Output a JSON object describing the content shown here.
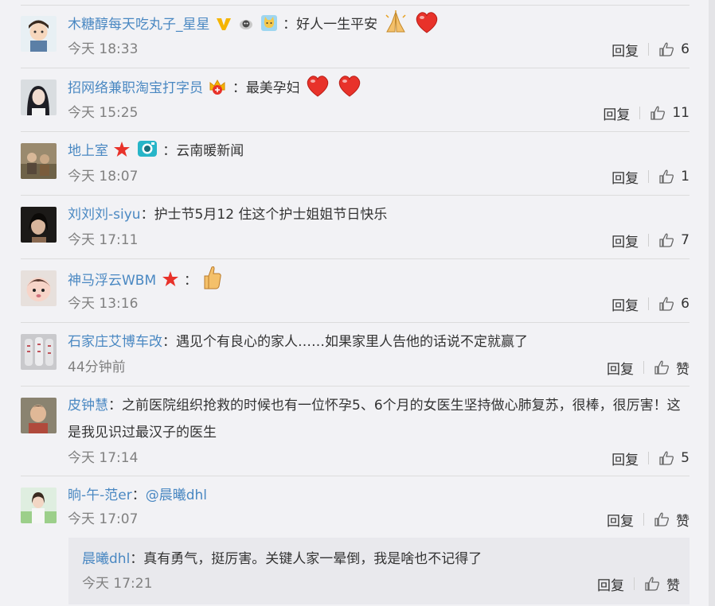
{
  "reply_label": "回复",
  "comments": [
    {
      "user": "木糖醇每天吃丸子_星星",
      "sep": "：",
      "text": "好人一生平安",
      "time": "今天 18:33",
      "likes": "6",
      "badges": [
        "verified-v-icon",
        "sheep-icon",
        "cat-badge-icon"
      ],
      "emojis": [
        "pray-emoji",
        "heart-emoji"
      ]
    },
    {
      "user": "招网络兼职淘宝打字员",
      "sep": "：",
      "text": "最美孕妇",
      "time": "今天 15:25",
      "likes": "11",
      "badges": [
        "crown-badge-icon"
      ],
      "emojis": [
        "heart-emoji",
        "heart-emoji"
      ]
    },
    {
      "user": "地上室",
      "sep": "：",
      "text": "云南暖新闻",
      "time": "今天 18:07",
      "likes": "1",
      "badges": [
        "star-badge-icon",
        "camera-badge-icon"
      ],
      "emojis": []
    },
    {
      "user": "刘刘刘-siyu",
      "sep": "：",
      "text": "护士节5月12 住这个护士姐姐节日快乐",
      "time": "今天 17:11",
      "likes": "7",
      "badges": [],
      "emojis": []
    },
    {
      "user": "神马浮云WBM",
      "sep": "：",
      "text": "",
      "time": "今天 13:16",
      "likes": "6",
      "badges": [
        "star-badge-icon"
      ],
      "emojis": [
        "thumbs-up-emoji"
      ]
    },
    {
      "user": "石家庄艾博车改",
      "sep": "：",
      "text": "遇见个有良心的家人……如果家里人告他的话说不定就赢了",
      "time": "44分钟前",
      "likes": "赞",
      "badges": [],
      "emojis": []
    },
    {
      "user": "皮钟慧",
      "sep": "：",
      "text": "之前医院组织抢救的时候也有一位怀孕5、6个月的女医生坚持做心肺复苏，很棒，很厉害！这是我见识过最汉子的医生",
      "time": "今天 17:14",
      "likes": "5",
      "badges": [],
      "emojis": []
    },
    {
      "user": "晌-午-范er",
      "sep": "：",
      "text": "@晨曦dhl",
      "time": "今天 17:07",
      "likes": "赞",
      "badges": [],
      "emojis": []
    }
  ],
  "nested_reply": {
    "user": "晨曦dhl",
    "sep": "：",
    "text": "真有勇气，挺厉害。关键人家一晕倒，我是啥也不记得了",
    "time": "今天 17:21",
    "likes": "赞"
  },
  "colors": {
    "username": "#4a88c2",
    "timestamp": "#808080",
    "background": "#f2f2f5",
    "nested_bg": "#e9e9ed"
  }
}
